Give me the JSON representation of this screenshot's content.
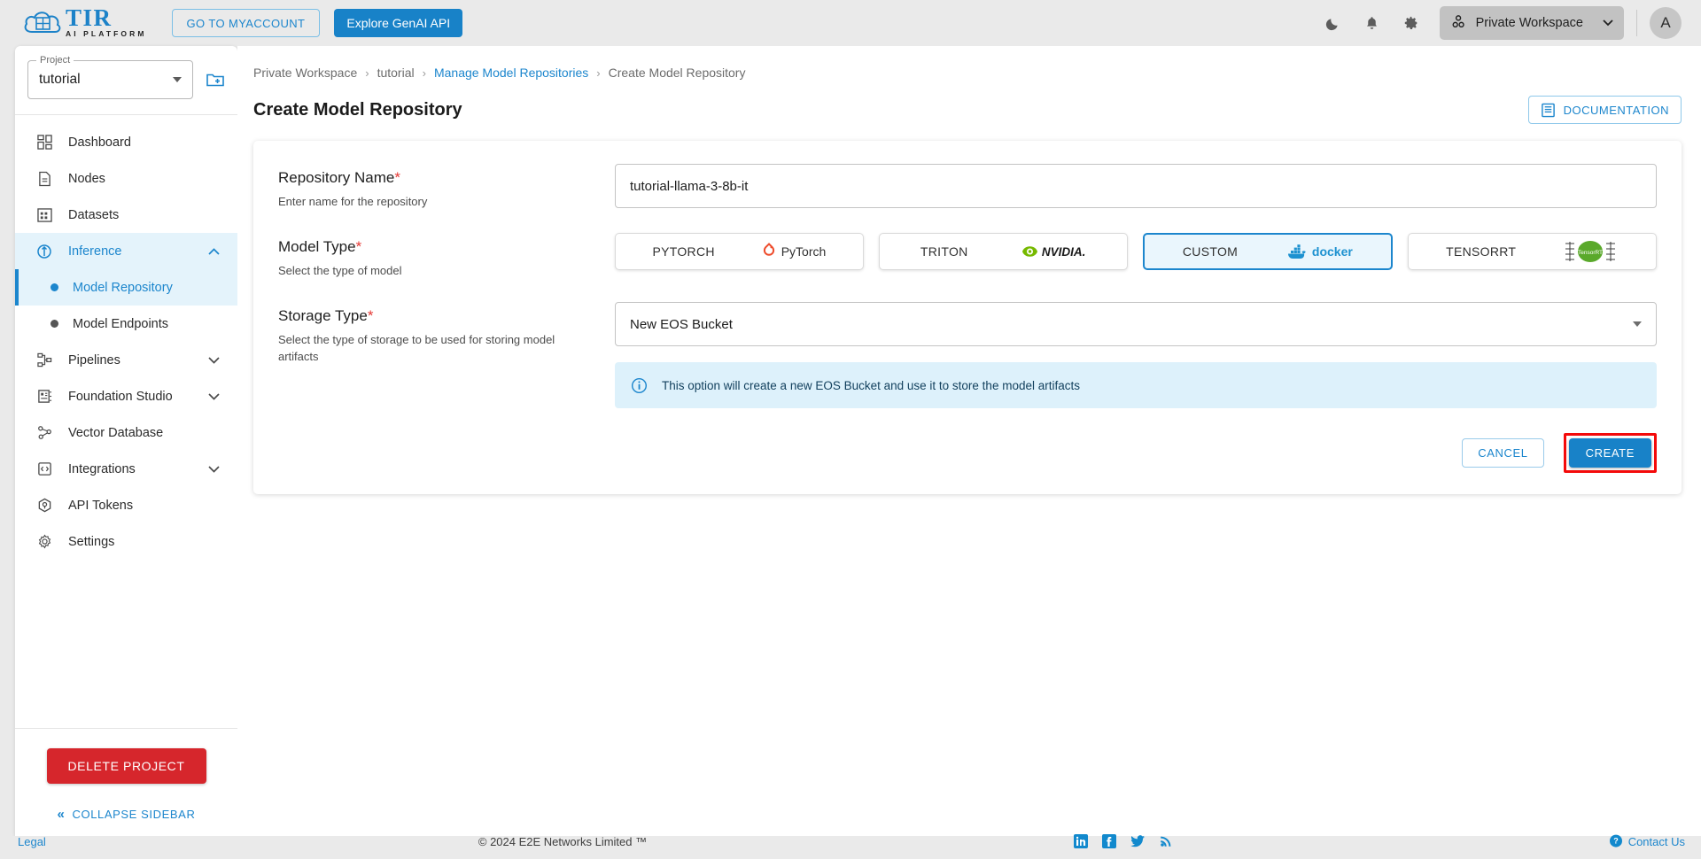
{
  "topbar": {
    "logo_name": "TIR",
    "logo_sub": "AI PLATFORM",
    "myaccount_label": "GO TO MYACCOUNT",
    "genai_label": "Explore GenAI API",
    "dark_mode_icon": "moon-icon",
    "notifications_icon": "bell-icon",
    "settings_icon": "gear-icon",
    "workspace_label": "Private Workspace",
    "workspace_icon": "workspace-icon",
    "avatar_initial": "A"
  },
  "sidebar": {
    "project_legend": "Project",
    "project_value": "tutorial",
    "add_project_icon": "add-folder-icon",
    "items": [
      {
        "label": "Dashboard",
        "icon": "dashboard-icon",
        "expandable": false,
        "active": false
      },
      {
        "label": "Nodes",
        "icon": "document-icon",
        "expandable": false,
        "active": false
      },
      {
        "label": "Datasets",
        "icon": "grid-icon",
        "expandable": false,
        "active": false
      },
      {
        "label": "Inference",
        "icon": "inference-icon",
        "expandable": true,
        "expanded": true,
        "active": true
      },
      {
        "label": "Pipelines",
        "icon": "pipelines-icon",
        "expandable": true,
        "expanded": false,
        "active": false
      },
      {
        "label": "Foundation Studio",
        "icon": "studio-icon",
        "expandable": true,
        "expanded": false,
        "active": false
      },
      {
        "label": "Vector Database",
        "icon": "vector-db-icon",
        "expandable": false,
        "active": false
      },
      {
        "label": "Integrations",
        "icon": "code-icon",
        "expandable": true,
        "expanded": false,
        "active": false
      },
      {
        "label": "API Tokens",
        "icon": "token-icon",
        "expandable": false,
        "active": false
      },
      {
        "label": "Settings",
        "icon": "settings-gear-icon",
        "expandable": false,
        "active": false
      }
    ],
    "sub_items": [
      {
        "label": "Model Repository",
        "active": true
      },
      {
        "label": "Model Endpoints",
        "active": false
      }
    ],
    "delete_label": "DELETE PROJECT",
    "collapse_label": "COLLAPSE SIDEBAR",
    "collapse_icon": "double-chevron-left-icon"
  },
  "breadcrumb": [
    {
      "label": "Private Workspace",
      "link": false
    },
    {
      "label": "tutorial",
      "link": false
    },
    {
      "label": "Manage Model Repositories",
      "link": true
    },
    {
      "label": "Create Model Repository",
      "link": false
    }
  ],
  "page": {
    "title": "Create Model Repository",
    "documentation_label": "DOCUMENTATION",
    "documentation_icon": "book-icon"
  },
  "form": {
    "repository_name": {
      "label": "Repository Name",
      "required_marker": "*",
      "description": "Enter name for the repository",
      "value": "tutorial-llama-3-8b-it",
      "placeholder": "Enter name for the repository"
    },
    "model_type": {
      "label": "Model Type",
      "required_marker": "*",
      "description": "Select the type of model",
      "options": [
        {
          "name": "PYTORCH",
          "logo": "pytorch-logo",
          "selected": false
        },
        {
          "name": "TRITON",
          "logo": "nvidia-logo",
          "selected": false
        },
        {
          "name": "CUSTOM",
          "logo": "docker-logo",
          "selected": true
        },
        {
          "name": "TENSORRT",
          "logo": "tensorrt-logo",
          "selected": false
        }
      ],
      "pytorch_wordmark": "PyTorch",
      "nvidia_wordmark": "NVIDIA.",
      "docker_wordmark": "docker",
      "tensorrt_wordmark": "TensorRT"
    },
    "storage_type": {
      "label": "Storage Type",
      "required_marker": "*",
      "description": "Select the type of storage to be used for storing model artifacts",
      "value": "New EOS Bucket",
      "dropdown_icon": "chevron-down-icon",
      "info_icon": "info-icon",
      "info_text": "This option will create a new EOS Bucket and use it to store the model artifacts"
    },
    "cancel_label": "CANCEL",
    "create_label": "CREATE",
    "create_highlight_color": "#f40a0a"
  },
  "footer": {
    "legal": "Legal",
    "copyright": "© 2024 E2E Networks Limited ™",
    "social": [
      "linkedin-icon",
      "facebook-icon",
      "twitter-icon",
      "rss-icon"
    ],
    "contact": "Contact Us",
    "contact_icon": "question-circle-icon"
  },
  "colors": {
    "accent": "#1882c8",
    "danger": "#d6262c",
    "highlight": "#f40a0a",
    "info_bg": "#ddf1fb",
    "active_nav_bg": "#e4f3fb"
  }
}
